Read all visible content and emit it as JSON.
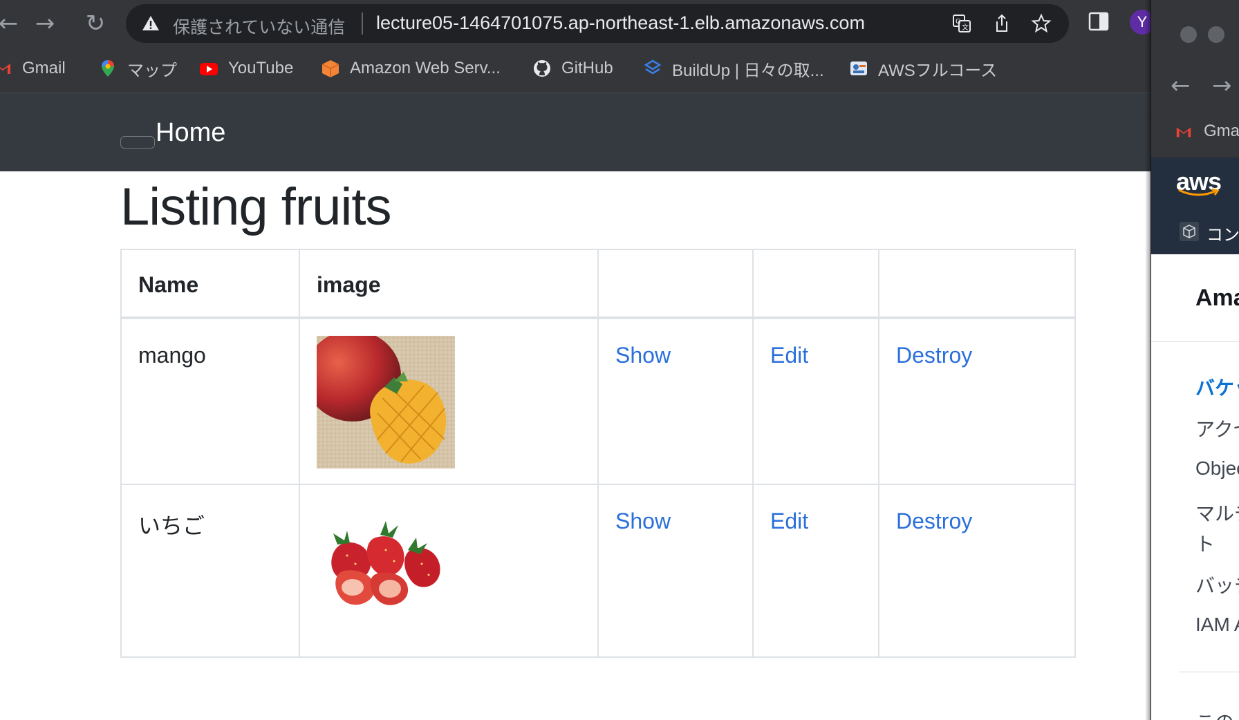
{
  "browser": {
    "security_text": "保護されていない通信",
    "url": "lecture05-1464701075.ap-northeast-1.elb.amazonaws.com",
    "profile_initial": "Y",
    "bookmarks": [
      {
        "label": "Gmail"
      },
      {
        "label": "マップ"
      },
      {
        "label": "YouTube"
      },
      {
        "label": "Amazon Web Serv..."
      },
      {
        "label": "GitHub"
      },
      {
        "label": "BuildUp | 日々の取..."
      },
      {
        "label": "AWSフルコース"
      }
    ]
  },
  "navbar": {
    "brand": "Home"
  },
  "main": {
    "title": "Listing fruits",
    "table": {
      "headers": [
        "Name",
        "image",
        "",
        "",
        ""
      ],
      "rows": [
        {
          "name": "mango",
          "image": "mango-photo",
          "show": "Show",
          "edit": "Edit",
          "destroy": "Destroy"
        },
        {
          "name": "いちご",
          "image": "strawberry-photo",
          "show": "Show",
          "edit": "Edit",
          "destroy": "Destroy"
        }
      ]
    }
  },
  "side_window": {
    "bookmark": "Gmai",
    "aws_logo": "aws",
    "console": "コン",
    "title": "Ama",
    "items": [
      "バケッ",
      "アクセ",
      "Objec",
      "マルチ",
      "ト",
      "バッチ",
      "IAM A",
      "この ア"
    ]
  },
  "colors": {
    "chrome_bg": "#35363a",
    "navbar_bg": "#343a40",
    "link": "#2a6fdb",
    "aws_bar": "#232f3e"
  }
}
